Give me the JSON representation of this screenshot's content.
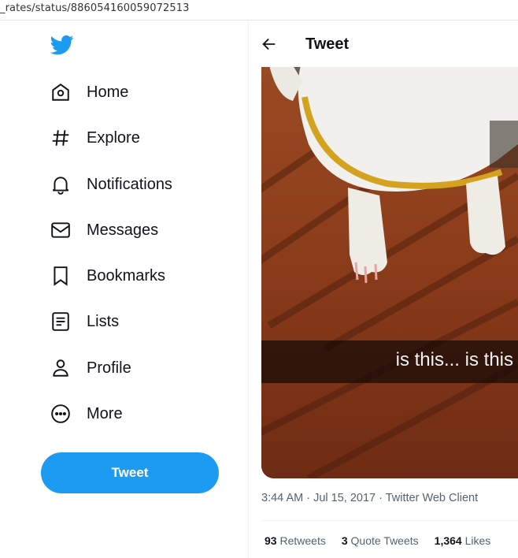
{
  "browser": {
    "url_fragment": "_rates/status/886054160059072513"
  },
  "brand": {
    "accent": "#1d9bf0",
    "logo_icon": "twitter-bird-icon"
  },
  "sidebar": {
    "items": [
      {
        "label": "Home",
        "icon": "home-icon"
      },
      {
        "label": "Explore",
        "icon": "hashtag-icon"
      },
      {
        "label": "Notifications",
        "icon": "bell-icon"
      },
      {
        "label": "Messages",
        "icon": "envelope-icon"
      },
      {
        "label": "Bookmarks",
        "icon": "bookmark-icon"
      },
      {
        "label": "Lists",
        "icon": "list-icon"
      },
      {
        "label": "Profile",
        "icon": "person-icon"
      },
      {
        "label": "More",
        "icon": "more-circle-icon"
      }
    ],
    "tweet_button": "Tweet"
  },
  "main": {
    "header_title": "Tweet",
    "media_caption": "is this... is this",
    "meta_line": "3:44 AM · Jul 15, 2017 · Twitter Web Client",
    "stats": {
      "retweets_count": "93",
      "retweets_label": "Retweets",
      "quotes_count": "3",
      "quotes_label": "Quote Tweets",
      "likes_count": "1,364",
      "likes_label": "Likes"
    }
  }
}
